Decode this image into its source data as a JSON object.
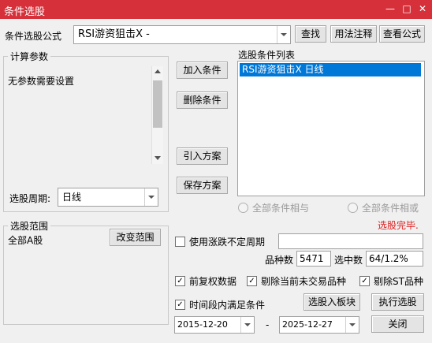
{
  "window": {
    "title": "条件选股",
    "min_glyph": "—",
    "max_glyph": "□",
    "close_glyph": "✕"
  },
  "formula": {
    "label": "条件选股公式",
    "value": "RSI游资狙击X  -",
    "find_button": "查找",
    "usage_button": "用法注释",
    "view_button": "查看公式"
  },
  "params": {
    "group_title": "计算参数",
    "text": "无参数需要设置",
    "period_label": "选股周期:",
    "period_value": "日线"
  },
  "actions": {
    "add_condition": "加入条件",
    "delete_condition": "删除条件",
    "import_scheme": "引入方案",
    "save_scheme": "保存方案"
  },
  "conditions": {
    "title": "选股条件列表",
    "items": [
      "RSI游资狙击X  日线"
    ],
    "mode_and": "全部条件相与",
    "mode_or": "全部条件相或"
  },
  "status": {
    "text": "选股完毕.",
    "color": "#e02020"
  },
  "range": {
    "group_title": "选股范围",
    "value": "全部A股",
    "change_button": "改变范围"
  },
  "options": {
    "uncertain_period_label": "使用涨跌不定周期",
    "stock_count_label": "品种数",
    "stock_count_value": "5471",
    "selected_label": "选中数",
    "selected_value": "64/1.2%",
    "forward_adjust_label": "前复权数据",
    "exclude_untraded_label": "剔除当前未交易品种",
    "exclude_st_label": "剔除ST品种",
    "time_range_label": "时间段内满足条件",
    "check_glyph": "✓"
  },
  "bottom": {
    "start_date": "2015-12-20",
    "dash": "-",
    "end_date": "2025-12-27",
    "add_to_block_button": "选股入板块",
    "execute_button": "执行选股",
    "close_button": "关闭"
  }
}
